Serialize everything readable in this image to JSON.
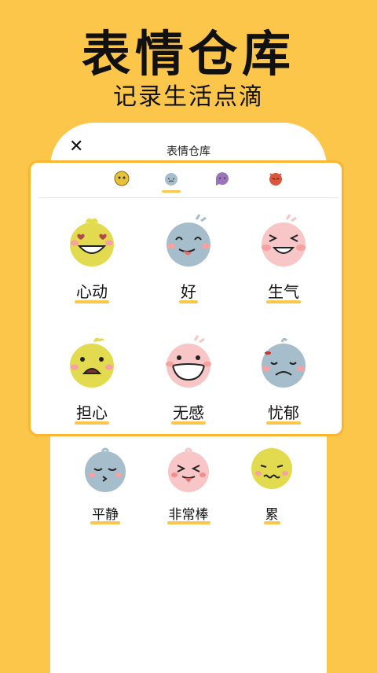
{
  "hero": {
    "title": "表情仓库",
    "subtitle": "记录生活点滴"
  },
  "screen": {
    "close_icon": "close-icon",
    "title": "表情仓库"
  },
  "tabs": [
    {
      "icon": "yellow-face-icon",
      "color": "#E8C13A",
      "active": false
    },
    {
      "icon": "blue-face-icon",
      "color": "#A6BDCB",
      "active": true
    },
    {
      "icon": "purple-face-icon",
      "color": "#9B75B9",
      "active": false
    },
    {
      "icon": "red-face-icon",
      "color": "#D9553E",
      "active": false
    }
  ],
  "moods": [
    {
      "label": "心动",
      "color": "#E3DB4F",
      "icon": "heart-eyes-face-icon"
    },
    {
      "label": "好",
      "color": "#A6BDCB",
      "icon": "tongue-out-face-icon"
    },
    {
      "label": "生气",
      "color": "#F8C6C6",
      "icon": "squint-laugh-face-icon"
    },
    {
      "label": "担心",
      "color": "#E3DB4F",
      "icon": "worried-face-icon"
    },
    {
      "label": "无感",
      "color": "#F8C6C6",
      "icon": "grin-face-icon"
    },
    {
      "label": "忧郁",
      "color": "#A6BDCB",
      "icon": "sad-face-icon"
    }
  ],
  "bottom_moods": [
    {
      "label": "平静",
      "color": "#A6BDCB",
      "icon": "calm-kiss-face-icon"
    },
    {
      "label": "非常棒",
      "color": "#F8C6C6",
      "icon": "wink-tongue-face-icon"
    },
    {
      "label": "累",
      "color": "#E3DB4F",
      "icon": "tired-face-icon"
    }
  ]
}
